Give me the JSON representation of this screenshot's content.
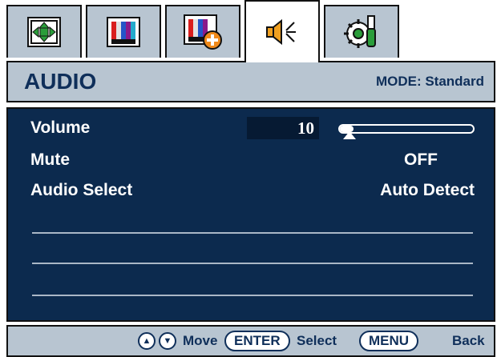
{
  "tabs": [
    {
      "icon": "picture-position-icon",
      "active": false
    },
    {
      "icon": "picture-icon",
      "active": false
    },
    {
      "icon": "picture-advanced-icon",
      "active": false
    },
    {
      "icon": "audio-speaker-icon",
      "active": true
    },
    {
      "icon": "system-settings-icon",
      "active": false
    }
  ],
  "header": {
    "title": "AUDIO",
    "mode": "MODE: Standard"
  },
  "menu": [
    {
      "label": "Volume",
      "value": "10",
      "slider_fraction": 0.1
    },
    {
      "label": "Mute",
      "value": "OFF"
    },
    {
      "label": "Audio Select",
      "value": "Auto Detect"
    }
  ],
  "footer": {
    "up_icon": "up-arrow-icon",
    "down_icon": "down-arrow-icon",
    "move_label": "Move",
    "enter_key": "ENTER",
    "select_label": "Select",
    "menu_key": "MENU",
    "back_label": "Back"
  },
  "colors": {
    "panel_bg": "#0c2a4e",
    "frame_bg": "#b8c5d1",
    "text_dark": "#0f2f5a",
    "text_light": "#ffffff"
  }
}
